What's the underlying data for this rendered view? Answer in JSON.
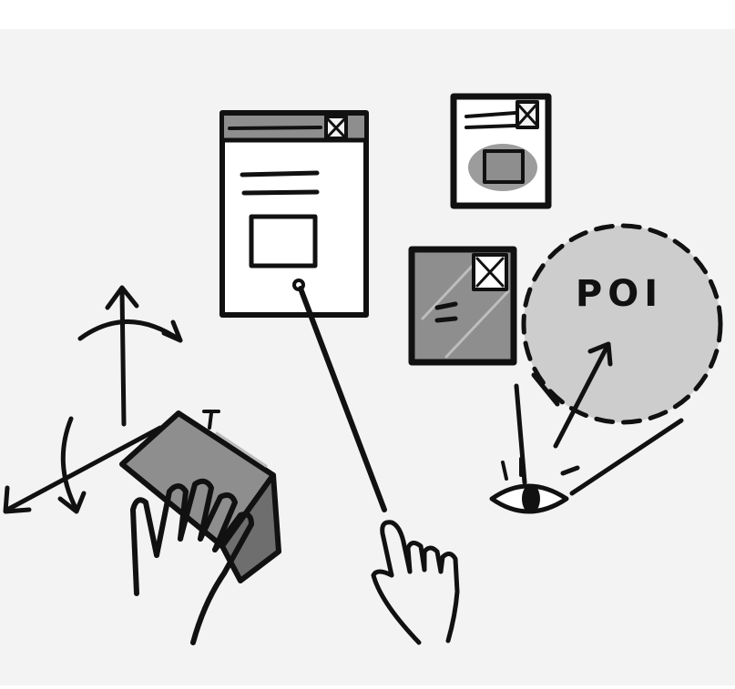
{
  "poi": {
    "label": "POI"
  },
  "colors": {
    "ink": "#111111",
    "canvas": "#f3f3f3",
    "panel_dark": "#8e8e8e",
    "panel_light": "#ffffff",
    "bubble": "#cdcdcd"
  },
  "icons": [
    "floating-window-icon",
    "minimized-window-icon",
    "folded-window-icon",
    "eye-icon",
    "pointing-hand-icon",
    "grabbing-hand-icon",
    "rotation-axes-icon"
  ]
}
